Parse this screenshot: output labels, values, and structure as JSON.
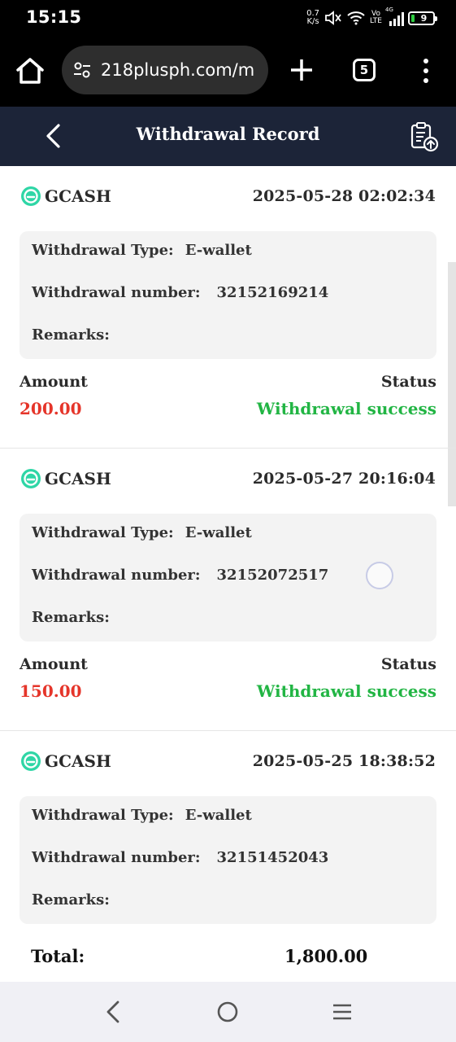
{
  "status_bar": {
    "time": "15:15",
    "net_speed_value": "0.7",
    "net_speed_unit": "K/s",
    "volte_top": "Vo",
    "volte_bottom": "LTE",
    "network": "4G",
    "battery": "9"
  },
  "browser": {
    "url": "218plusph.com/m",
    "tab_count": "5"
  },
  "header": {
    "title": "Withdrawal Record"
  },
  "labels": {
    "withdrawal_type": "Withdrawal Type:",
    "withdrawal_number": "Withdrawal number:",
    "remarks": "Remarks:",
    "amount": "Amount",
    "status": "Status"
  },
  "records": [
    {
      "method": "GCASH",
      "date": "2025-05-28 02:02:34",
      "type": "E-wallet",
      "number": "32152169214",
      "remarks": "",
      "amount": "200.00",
      "status": "Withdrawal success"
    },
    {
      "method": "GCASH",
      "date": "2025-05-27 20:16:04",
      "type": "E-wallet",
      "number": "32152072517",
      "remarks": "",
      "amount": "150.00",
      "status": "Withdrawal success"
    },
    {
      "method": "GCASH",
      "date": "2025-05-25 18:38:52",
      "type": "E-wallet",
      "number": "32151452043",
      "remarks": "",
      "amount": "",
      "status": ""
    }
  ],
  "total": {
    "label": "Total:",
    "value": "1,800.00"
  },
  "colors": {
    "header_bg": "#1c2438",
    "amount": "#e5352a",
    "status_success": "#22b544",
    "gcash": "#2fd6a6"
  }
}
